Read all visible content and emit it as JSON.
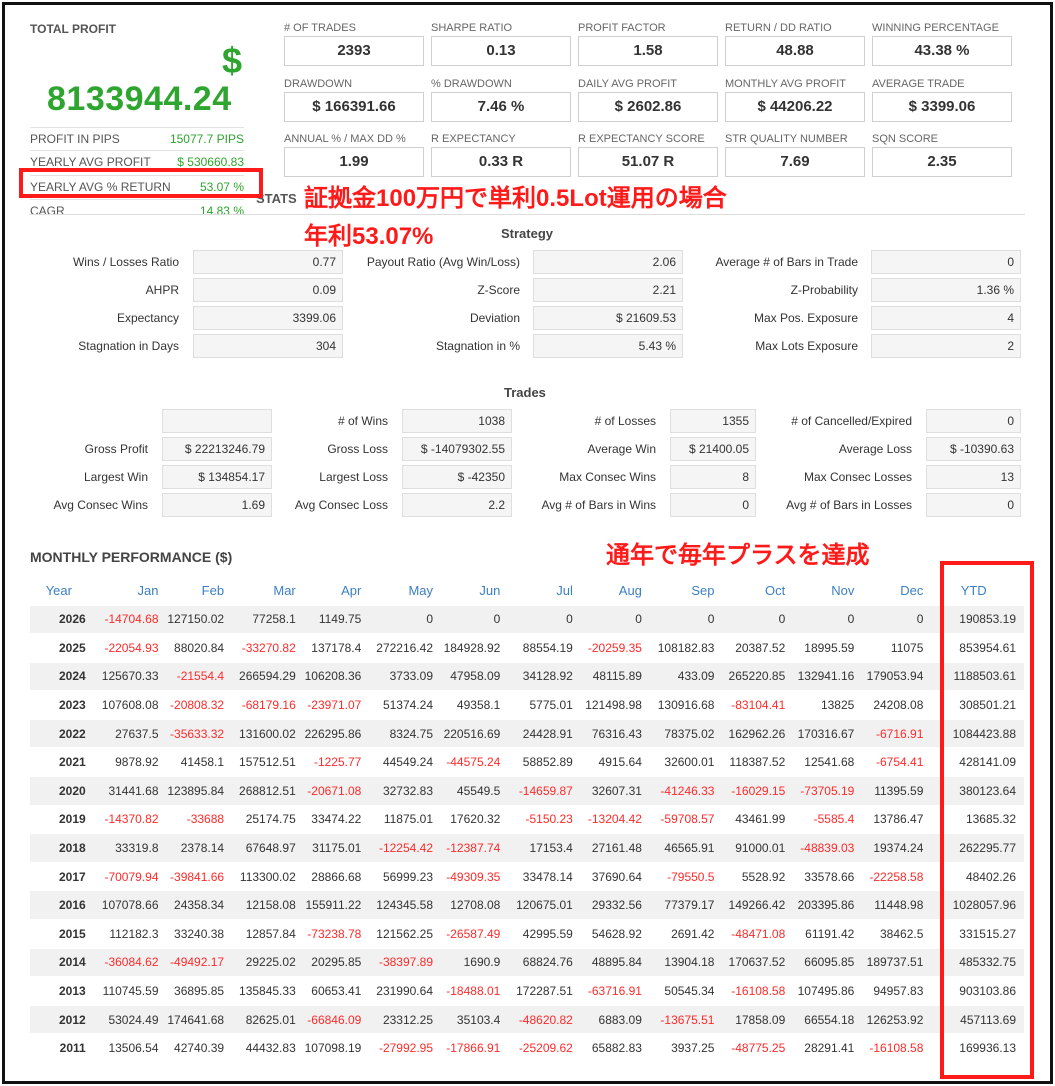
{
  "total_profit": {
    "title": "TOTAL PROFIT",
    "currency": "$",
    "value": "8133944.24",
    "rows": [
      {
        "label": "PROFIT IN PIPS",
        "value": "15077.7 PIPS"
      },
      {
        "label": "YEARLY AVG PROFIT",
        "value": "$ 530660.83"
      },
      {
        "label": "YEARLY AVG % RETURN",
        "value": "53.07 %"
      },
      {
        "label": "CAGR",
        "value": "14.83 %"
      }
    ]
  },
  "metrics": [
    {
      "label": "# OF TRADES",
      "value": "2393"
    },
    {
      "label": "SHARPE RATIO",
      "value": "0.13"
    },
    {
      "label": "PROFIT FACTOR",
      "value": "1.58"
    },
    {
      "label": "RETURN / DD RATIO",
      "value": "48.88"
    },
    {
      "label": "WINNING PERCENTAGE",
      "value": "43.38 %"
    },
    {
      "label": "DRAWDOWN",
      "value": "$ 166391.66"
    },
    {
      "label": "% DRAWDOWN",
      "value": "7.46 %"
    },
    {
      "label": "DAILY AVG PROFIT",
      "value": "$ 2602.86"
    },
    {
      "label": "MONTHLY AVG PROFIT",
      "value": "$ 44206.22"
    },
    {
      "label": "AVERAGE TRADE",
      "value": "$ 3399.06"
    },
    {
      "label": "ANNUAL % / MAX DD %",
      "value": "1.99"
    },
    {
      "label": "R EXPECTANCY",
      "value": "0.33 R"
    },
    {
      "label": "R EXPECTANCY SCORE",
      "value": "51.07 R"
    },
    {
      "label": "STR QUALITY NUMBER",
      "value": "7.69"
    },
    {
      "label": "SQN SCORE",
      "value": "2.35"
    }
  ],
  "stats_label": "STATS",
  "strategy": {
    "title": "Strategy",
    "rows": [
      [
        {
          "label": "Wins / Losses Ratio",
          "value": "0.77"
        },
        {
          "label": "Payout Ratio (Avg Win/Loss)",
          "value": "2.06"
        },
        {
          "label": "Average # of Bars in Trade",
          "value": "0"
        }
      ],
      [
        {
          "label": "AHPR",
          "value": "0.09"
        },
        {
          "label": "Z-Score",
          "value": "2.21"
        },
        {
          "label": "Z-Probability",
          "value": "1.36 %"
        }
      ],
      [
        {
          "label": "Expectancy",
          "value": "3399.06"
        },
        {
          "label": "Deviation",
          "value": "$ 21609.53"
        },
        {
          "label": "Max Pos. Exposure",
          "value": "4"
        }
      ],
      [
        {
          "label": "Stagnation in Days",
          "value": "304"
        },
        {
          "label": "Stagnation in %",
          "value": "5.43 %"
        },
        {
          "label": "Max Lots Exposure",
          "value": "2"
        }
      ]
    ]
  },
  "trades": {
    "title": "Trades",
    "rows": [
      [
        {
          "label": "",
          "value": ""
        },
        {
          "label": "# of Wins",
          "value": "1038"
        },
        {
          "label": "# of Losses",
          "value": "1355"
        },
        {
          "label": "# of Cancelled/Expired",
          "value": "0"
        }
      ],
      [
        {
          "label": "Gross Profit",
          "value": "$ 22213246.79"
        },
        {
          "label": "Gross Loss",
          "value": "$ -14079302.55"
        },
        {
          "label": "Average Win",
          "value": "$ 21400.05"
        },
        {
          "label": "Average Loss",
          "value": "$ -10390.63"
        }
      ],
      [
        {
          "label": "Largest Win",
          "value": "$ 134854.17"
        },
        {
          "label": "Largest Loss",
          "value": "$ -42350"
        },
        {
          "label": "Max Consec Wins",
          "value": "8"
        },
        {
          "label": "Max Consec Losses",
          "value": "13"
        }
      ],
      [
        {
          "label": "Avg Consec Wins",
          "value": "1.69"
        },
        {
          "label": "Avg Consec Loss",
          "value": "2.2"
        },
        {
          "label": "Avg # of Bars in Wins",
          "value": "0"
        },
        {
          "label": "Avg # of Bars in Losses",
          "value": "0"
        }
      ]
    ]
  },
  "annotations": {
    "line1": "証拠金100万円で単利0.5Lot運用の場合",
    "line2": "年利53.07%",
    "line3": "通年で毎年プラスを達成",
    "color": "#ff1a1a"
  },
  "monthly": {
    "title": "MONTHLY PERFORMANCE ($)",
    "headers": [
      "Year",
      "Jan",
      "Feb",
      "Mar",
      "Apr",
      "May",
      "Jun",
      "Jul",
      "Aug",
      "Sep",
      "Oct",
      "Nov",
      "Dec",
      "YTD"
    ],
    "rows": [
      [
        "2026",
        "-14704.68",
        "127150.02",
        "77258.1",
        "1149.75",
        "0",
        "0",
        "0",
        "0",
        "0",
        "0",
        "0",
        "0",
        "190853.19"
      ],
      [
        "2025",
        "-22054.93",
        "88020.84",
        "-33270.82",
        "137178.4",
        "272216.42",
        "184928.92",
        "88554.19",
        "-20259.35",
        "108182.83",
        "20387.52",
        "18995.59",
        "11075",
        "853954.61"
      ],
      [
        "2024",
        "125670.33",
        "-21554.4",
        "266594.29",
        "106208.36",
        "3733.09",
        "47958.09",
        "34128.92",
        "48115.89",
        "433.09",
        "265220.85",
        "132941.16",
        "179053.94",
        "1188503.61"
      ],
      [
        "2023",
        "107608.08",
        "-20808.32",
        "-68179.16",
        "-23971.07",
        "51374.24",
        "49358.1",
        "5775.01",
        "121498.98",
        "130916.68",
        "-83104.41",
        "13825",
        "24208.08",
        "308501.21"
      ],
      [
        "2022",
        "27637.5",
        "-35633.32",
        "131600.02",
        "226295.86",
        "8324.75",
        "220516.69",
        "24428.91",
        "76316.43",
        "78375.02",
        "162962.26",
        "170316.67",
        "-6716.91",
        "1084423.88"
      ],
      [
        "2021",
        "9878.92",
        "41458.1",
        "157512.51",
        "-1225.77",
        "44549.24",
        "-44575.24",
        "58852.89",
        "4915.64",
        "32600.01",
        "118387.52",
        "12541.68",
        "-6754.41",
        "428141.09"
      ],
      [
        "2020",
        "31441.68",
        "123895.84",
        "268812.51",
        "-20671.08",
        "32732.83",
        "45549.5",
        "-14659.87",
        "32607.31",
        "-41246.33",
        "-16029.15",
        "-73705.19",
        "11395.59",
        "380123.64"
      ],
      [
        "2019",
        "-14370.82",
        "-33688",
        "25174.75",
        "33474.22",
        "11875.01",
        "17620.32",
        "-5150.23",
        "-13204.42",
        "-59708.57",
        "43461.99",
        "-5585.4",
        "13786.47",
        "13685.32"
      ],
      [
        "2018",
        "33319.8",
        "2378.14",
        "67648.97",
        "31175.01",
        "-12254.42",
        "-12387.74",
        "17153.4",
        "27161.48",
        "46565.91",
        "91000.01",
        "-48839.03",
        "19374.24",
        "262295.77"
      ],
      [
        "2017",
        "-70079.94",
        "-39841.66",
        "113300.02",
        "28866.68",
        "56999.23",
        "-49309.35",
        "33478.14",
        "37690.64",
        "-79550.5",
        "5528.92",
        "33578.66",
        "-22258.58",
        "48402.26"
      ],
      [
        "2016",
        "107078.66",
        "24358.34",
        "12158.08",
        "155911.22",
        "124345.58",
        "12708.08",
        "120675.01",
        "29332.56",
        "77379.17",
        "149266.42",
        "203395.86",
        "11448.98",
        "1028057.96"
      ],
      [
        "2015",
        "112182.3",
        "33240.38",
        "12857.84",
        "-73238.78",
        "121562.25",
        "-26587.49",
        "42995.59",
        "54628.92",
        "2691.42",
        "-48471.08",
        "61191.42",
        "38462.5",
        "331515.27"
      ],
      [
        "2014",
        "-36084.62",
        "-49492.17",
        "29225.02",
        "20295.85",
        "-38397.89",
        "1690.9",
        "68824.76",
        "48895.84",
        "13904.18",
        "170637.52",
        "66095.85",
        "189737.51",
        "485332.75"
      ],
      [
        "2013",
        "110745.59",
        "36895.85",
        "135845.33",
        "60653.41",
        "231990.64",
        "-18488.01",
        "172287.51",
        "-63716.91",
        "50545.34",
        "-16108.58",
        "107495.86",
        "94957.83",
        "903103.86"
      ],
      [
        "2012",
        "53024.49",
        "174641.68",
        "82625.01",
        "-66846.09",
        "23312.25",
        "35103.4",
        "-48620.82",
        "6883.09",
        "-13675.51",
        "17858.09",
        "66554.18",
        "126253.92",
        "457113.69"
      ],
      [
        "2011",
        "13506.54",
        "42740.39",
        "44432.83",
        "107098.19",
        "-27992.95",
        "-17866.91",
        "-25209.62",
        "65882.83",
        "3937.25",
        "-48775.25",
        "28291.41",
        "-16108.58",
        "169936.13"
      ]
    ]
  }
}
